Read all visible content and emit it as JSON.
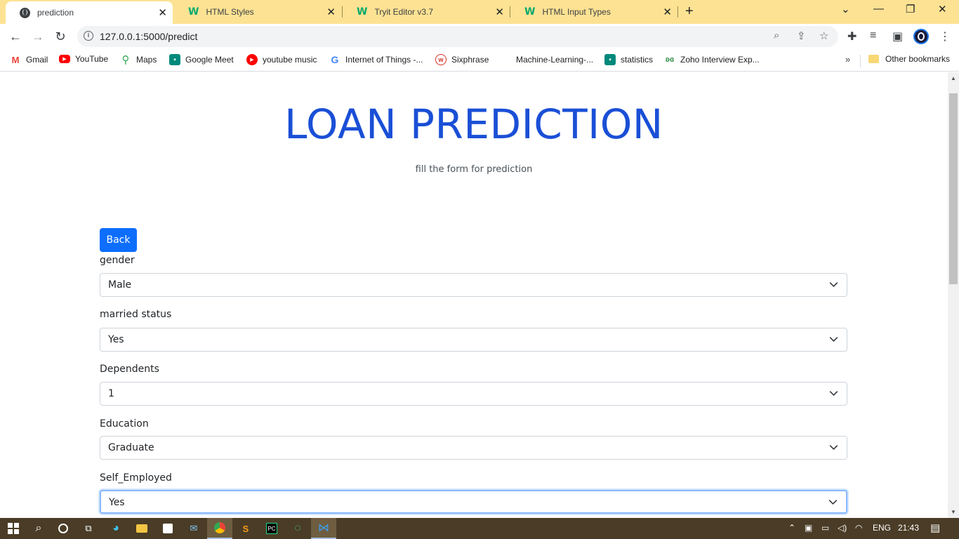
{
  "tabs": [
    {
      "title": "prediction",
      "icon": "globe-icon",
      "active": true
    },
    {
      "title": "HTML Styles",
      "icon": "w3schools-icon"
    },
    {
      "title": "Tryit Editor v3.7",
      "icon": "w3schools-icon"
    },
    {
      "title": "HTML Input Types",
      "icon": "w3schools-icon"
    }
  ],
  "address_bar": {
    "url": "127.0.0.1:5000/predict"
  },
  "bookmarks": [
    {
      "label": "Gmail",
      "icon": "gmail-icon",
      "color": "#ea4335"
    },
    {
      "label": "YouTube",
      "icon": "youtube-icon",
      "color": "#ff0000"
    },
    {
      "label": "Maps",
      "icon": "maps-icon",
      "color": "#34a853"
    },
    {
      "label": "Google Meet",
      "icon": "meet-icon",
      "color": "#00897b"
    },
    {
      "label": "youtube music",
      "icon": "youtube-music-icon",
      "color": "#ff0000"
    },
    {
      "label": "Internet of Things -...",
      "icon": "google-icon",
      "color": "#4285f4"
    },
    {
      "label": "Sixphrase",
      "icon": "sixphrase-icon",
      "color": "#d93025"
    },
    {
      "label": "Machine-Learning-...",
      "icon": "blank-icon",
      "color": "#ffffff"
    },
    {
      "label": "statistics",
      "icon": "meet-icon",
      "color": "#00897b"
    },
    {
      "label": "Zoho Interview Exp...",
      "icon": "geeks-icon",
      "color": "#2f8d46"
    }
  ],
  "other_bookmarks": "Other bookmarks",
  "page": {
    "title": "LOAN PREDICTION",
    "subtitle": "fill the form for prediction",
    "back_label": "Back"
  },
  "form": {
    "fields": [
      {
        "label": "gender",
        "value": "Male"
      },
      {
        "label": "married status",
        "value": "Yes"
      },
      {
        "label": "Dependents",
        "value": "1"
      },
      {
        "label": "Education",
        "value": "Graduate"
      },
      {
        "label": "Self_Employed",
        "value": "Yes"
      }
    ]
  },
  "taskbar": {
    "language": "ENG",
    "time": "21:43"
  },
  "colors": {
    "title": "#1a4fd6",
    "button": "#0d6efd",
    "tabstrip": "#fde293"
  }
}
